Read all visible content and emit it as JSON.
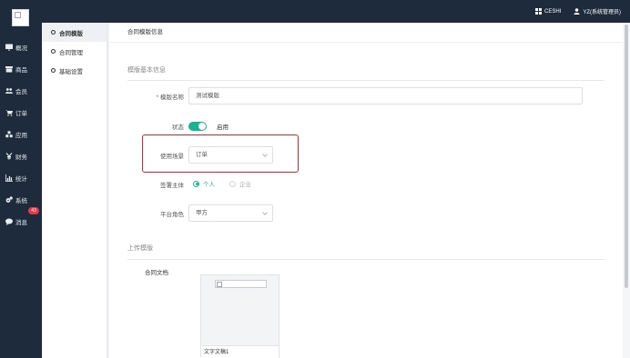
{
  "topbar": {
    "workspace_label": "CESHI",
    "user_label": "YZ(系统管理员)"
  },
  "sidebar": {
    "items": [
      {
        "label": "概况",
        "icon": "monitor-icon"
      },
      {
        "label": "商品",
        "icon": "box-icon"
      },
      {
        "label": "会员",
        "icon": "users-icon"
      },
      {
        "label": "订单",
        "icon": "cart-icon"
      },
      {
        "label": "应用",
        "icon": "cubes-icon"
      },
      {
        "label": "财务",
        "icon": "yen-icon"
      },
      {
        "label": "统计",
        "icon": "bar-chart-icon"
      },
      {
        "label": "系统",
        "icon": "gears-icon"
      },
      {
        "label": "消息",
        "icon": "chat-icon",
        "badge": "43"
      }
    ]
  },
  "subnav": {
    "items": [
      {
        "label": "合同模版",
        "active": true
      },
      {
        "label": "合同管理",
        "active": false
      },
      {
        "label": "基础设置",
        "active": false
      }
    ]
  },
  "main": {
    "breadcrumb": "合同模版信息",
    "basic_section_title": "模版基本信息",
    "template_name_label": "模版名称",
    "template_name_required": "*",
    "template_name_value": "测试模版",
    "status_label": "状态",
    "status_value": "启用",
    "scene_label": "使用场景",
    "scene_value": "订单",
    "signer_label": "签署主体",
    "signer_options": [
      "个人",
      "企业"
    ],
    "signer_selected": "个人",
    "role_label": "平台角色",
    "role_value": "甲方",
    "upload_section_title": "上传模版",
    "doc_label": "合同文档",
    "doc_name": "文字文稿1"
  },
  "colors": {
    "nav_bg": "#1e2b3c",
    "accent": "#19b394",
    "highlight_border": "#d9262c",
    "badge": "#e5394a"
  }
}
